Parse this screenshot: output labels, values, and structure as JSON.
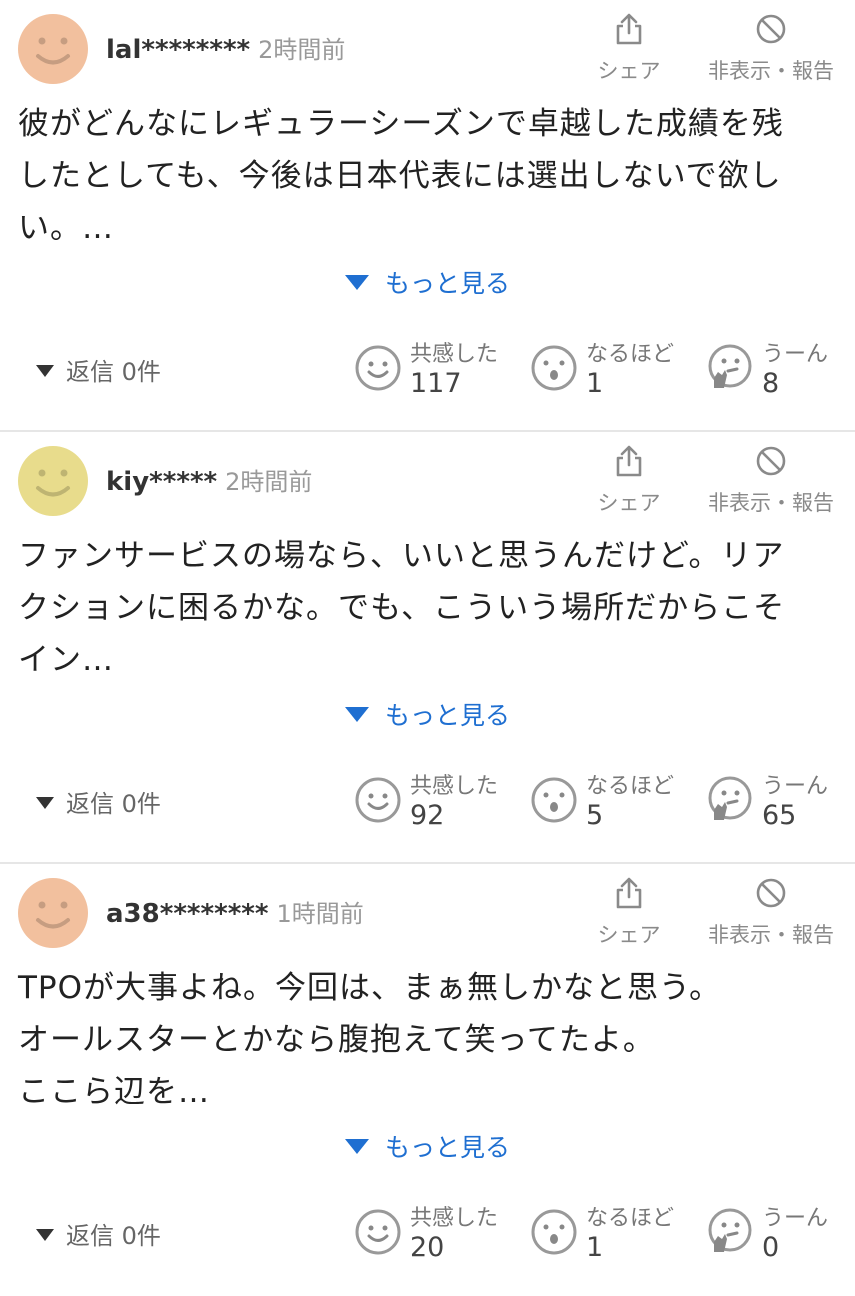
{
  "labels": {
    "share": "シェア",
    "hide_report": "非表示・報告",
    "more": "もっと見る",
    "reaction_empathy": "共感した",
    "reaction_indeed": "なるほど",
    "reaction_hmm": "うーん"
  },
  "icons": [
    "share-icon",
    "block-icon",
    "smile-face-icon",
    "surprised-face-icon",
    "hmm-face-icon",
    "expand-triangle-icon"
  ],
  "colors": {
    "link": "#1f6fd1",
    "avatar_orange": "#f2c09e",
    "avatar_yellow": "#e8dc8c"
  },
  "comments": [
    {
      "user": "lal********",
      "time": "2時間前",
      "avatar_color": "#f2c09e",
      "lines": [
        "彼がどんなにレギュラーシーズンで卓越した成績を残",
        "したとしても、今後は日本代表には選出しないで欲し",
        "い。…"
      ],
      "replies": "返信 0件",
      "empathy": "117",
      "indeed": "1",
      "hmm": "8"
    },
    {
      "user": "kiy*****",
      "time": "2時間前",
      "avatar_color": "#e8dc8c",
      "lines": [
        "ファンサービスの場なら、いいと思うんだけど。リア",
        "クションに困るかな。でも、こういう場所だからこそ",
        "イン…"
      ],
      "replies": "返信 0件",
      "empathy": "92",
      "indeed": "5",
      "hmm": "65"
    },
    {
      "user": "a38********",
      "time": "1時間前",
      "avatar_color": "#f2c09e",
      "lines": [
        "TPOが大事よね。今回は、まぁ無しかなと思う。",
        "オールスターとかなら腹抱えて笑ってたよ。",
        "ここら辺を…"
      ],
      "replies": "返信 0件",
      "empathy": "20",
      "indeed": "1",
      "hmm": "0"
    }
  ]
}
